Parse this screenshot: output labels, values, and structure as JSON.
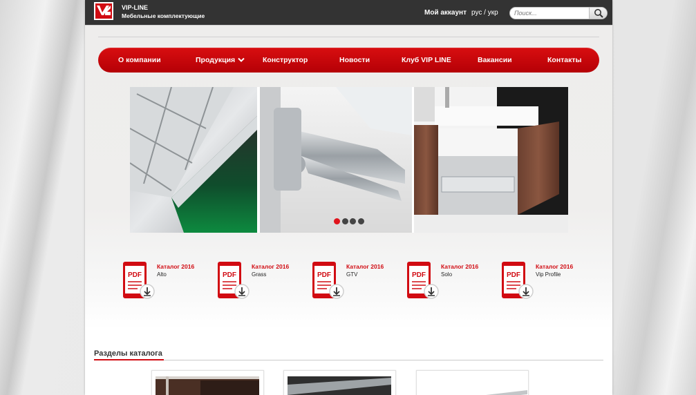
{
  "header": {
    "brand_title": "VIP-LINE",
    "brand_subtitle": "Мебельные комплектующие",
    "account_link": "Мой аккаунт",
    "lang_ru": "рус",
    "lang_sep": "/",
    "lang_uk": "укр",
    "search_placeholder": "Поиск..."
  },
  "nav": {
    "items": [
      {
        "label": "О компании"
      },
      {
        "label": "Продукция"
      },
      {
        "label": "Конструктор"
      },
      {
        "label": "Новости"
      },
      {
        "label": "Клуб VIP LINE"
      },
      {
        "label": "Вакансии"
      },
      {
        "label": "Контакты"
      }
    ]
  },
  "slider": {
    "active_dot": 1,
    "dot_count": 4
  },
  "catalogs": [
    {
      "title": "Каталог 2016",
      "name": "Alto",
      "icon": "pdf-download-icon"
    },
    {
      "title": "Каталог 2016",
      "name": "Grass",
      "icon": "pdf-download-icon"
    },
    {
      "title": "Каталог 2016",
      "name": "GTV",
      "icon": "pdf-download-icon"
    },
    {
      "title": "Каталог 2016",
      "name": "Solo",
      "icon": "pdf-download-icon"
    },
    {
      "title": "Каталог 2016",
      "name": "Vip Profile",
      "icon": "pdf-download-icon"
    }
  ],
  "pdf_label": "PDF",
  "sections": {
    "title": "Разделы каталога"
  },
  "colors": {
    "accent": "#d10b12",
    "topbar": "#333333",
    "dot_active": "#e0141c",
    "dot_inactive": "#444444"
  }
}
